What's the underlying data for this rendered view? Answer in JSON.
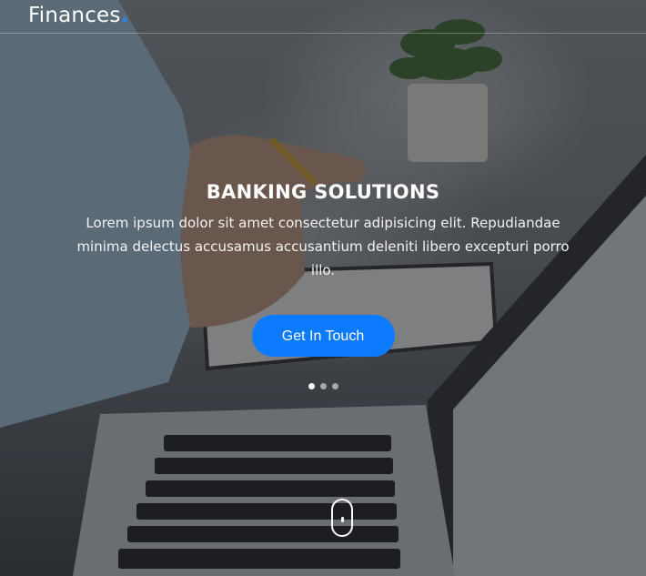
{
  "brand": {
    "name": "Finances",
    "accent": ".",
    "accent_color": "#1e88ff"
  },
  "slider": {
    "title": "BANKING SOLUTIONS",
    "text": "Lorem ipsum dolor sit amet consectetur adipisicing elit. Repudiandae minima delectus accusamus accusantium deleniti libero excepturi porro illo.",
    "cta_label": "Get In Touch",
    "cta_color": "#0d7bff",
    "slide_count": 3,
    "active_slide": 1
  },
  "scroll_indicator": {
    "icon": "mouse-scroll-icon"
  }
}
